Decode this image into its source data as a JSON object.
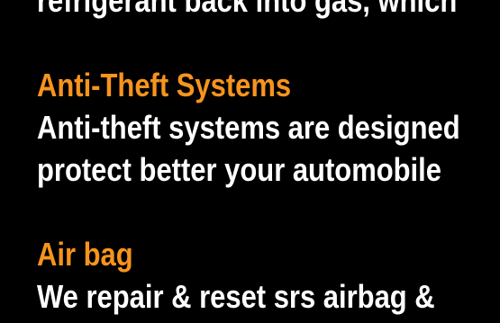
{
  "colors": {
    "background": "#000000",
    "body_text": "#ffffff",
    "heading_text": "#f7941d"
  },
  "intro": {
    "line1": "refrigerant back into gas, which"
  },
  "anti_theft": {
    "heading": "Anti-Theft Systems",
    "line1": "Anti-theft systems are designed",
    "line2": "protect better your automobile"
  },
  "airbag": {
    "heading": "Air bag",
    "line1": "We  repair & reset srs airbag &"
  }
}
